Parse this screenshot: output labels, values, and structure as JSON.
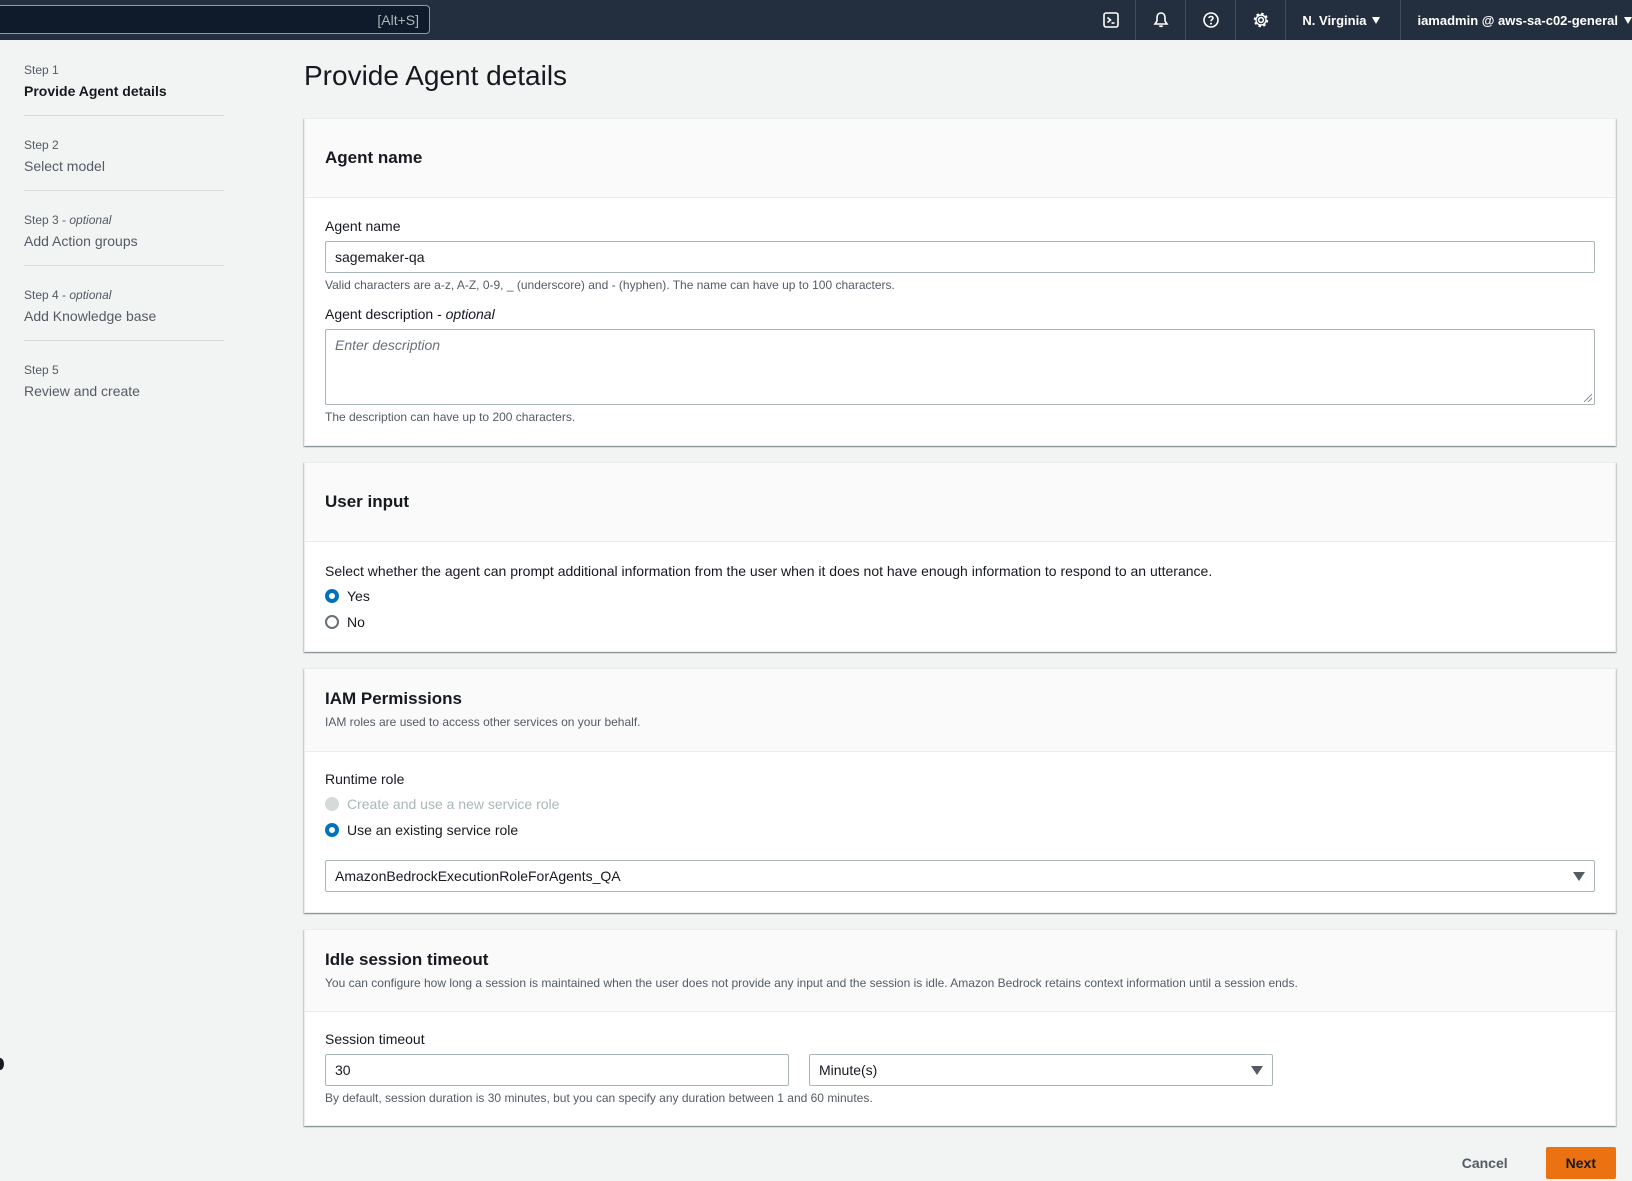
{
  "topnav": {
    "search_shortcut": "[Alt+S]",
    "region": "N. Virginia",
    "account": "iamadmin @ aws-sa-c02-general",
    "icons": [
      "cloudshell-icon",
      "bell-icon",
      "help-icon",
      "gear-icon"
    ]
  },
  "steps": [
    {
      "num": "Step 1",
      "optional": "",
      "title": "Provide Agent details",
      "active": true
    },
    {
      "num": "Step 2",
      "optional": "",
      "title": "Select model"
    },
    {
      "num": "Step 3",
      "optional": "optional",
      "title": "Add Action groups"
    },
    {
      "num": "Step 4",
      "optional": "optional",
      "title": "Add Knowledge base"
    },
    {
      "num": "Step 5",
      "optional": "",
      "title": "Review and create"
    }
  ],
  "page_title": "Provide Agent details",
  "agent_name_section": {
    "title": "Agent name",
    "name_label": "Agent name",
    "name_value": "sagemaker-qa",
    "name_hint": "Valid characters are a-z, A-Z, 0-9, _ (underscore) and - (hyphen). The name can have up to 100 characters.",
    "desc_label": "Agent description",
    "desc_optional": "optional",
    "desc_placeholder": "Enter description",
    "desc_hint": "The description can have up to 200 characters."
  },
  "user_input_section": {
    "title": "User input",
    "question": "Select whether the agent can prompt additional information from the user when it does not have enough information to respond to an utterance.",
    "options": [
      "Yes",
      "No"
    ],
    "selected": "Yes"
  },
  "iam_section": {
    "title": "IAM Permissions",
    "description": "IAM roles are used to access other services on your behalf.",
    "runtime_label": "Runtime role",
    "option_new": "Create and use a new service role",
    "option_existing": "Use an existing service role",
    "selected": "Use an existing service role",
    "role_value": "AmazonBedrockExecutionRoleForAgents_QA"
  },
  "idle_section": {
    "title": "Idle session timeout",
    "description": "You can configure how long a session is maintained when the user does not provide any input and the session is idle. Amazon Bedrock retains context information until a session ends.",
    "timeout_label": "Session timeout",
    "timeout_value": "30",
    "unit_value": "Minute(s)",
    "hint": "By default, session duration is 30 minutes, but you can specify any duration between 1 and 60 minutes."
  },
  "actions": {
    "cancel": "Cancel",
    "next": "Next"
  }
}
